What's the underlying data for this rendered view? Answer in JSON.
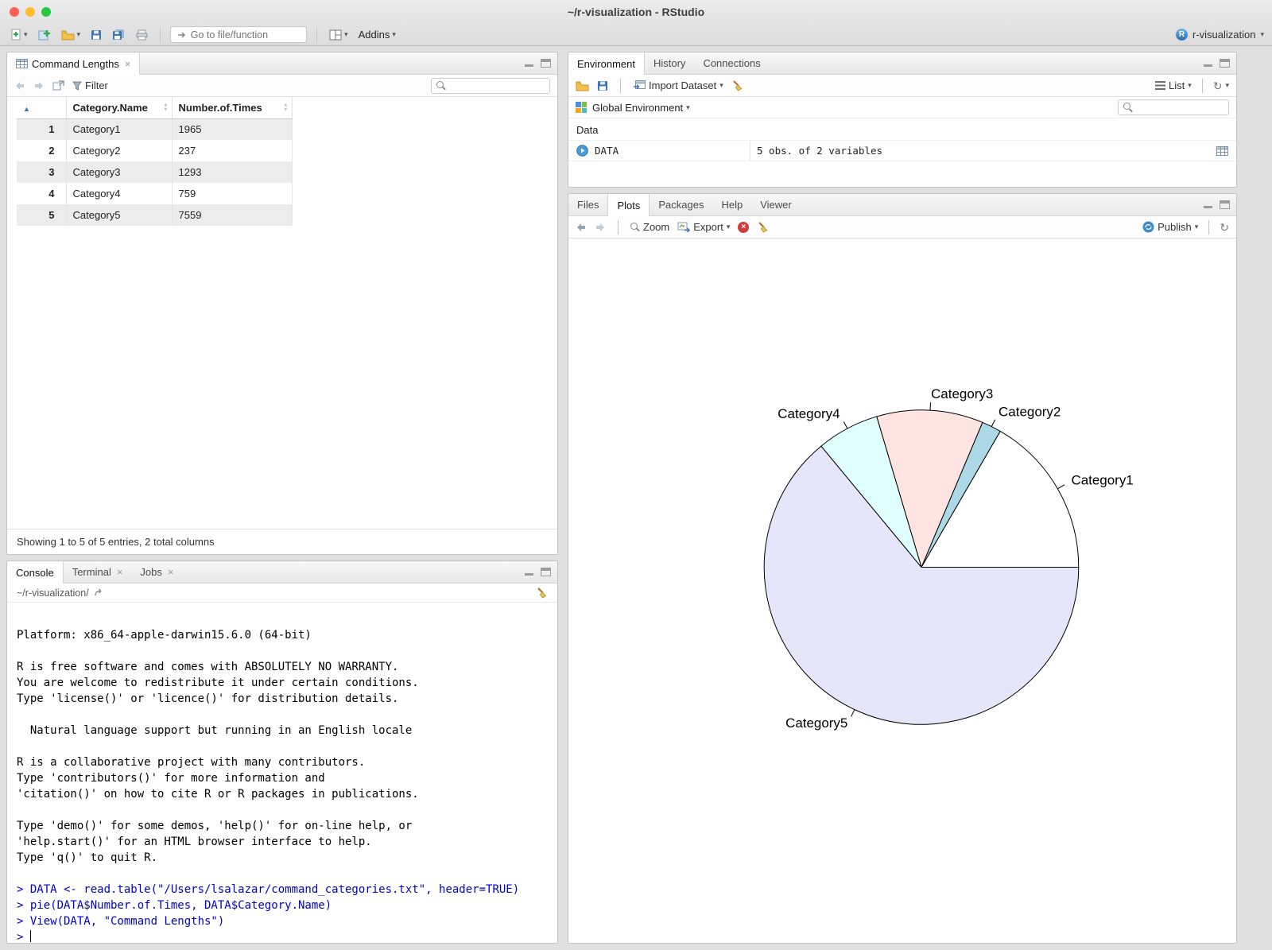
{
  "window": {
    "title": "~/r-visualization - RStudio"
  },
  "main_toolbar": {
    "goto_placeholder": "Go to file/function",
    "addins_label": "Addins",
    "project_label": "r-visualization"
  },
  "data_viewer": {
    "tab_title": "Command Lengths",
    "filter_label": "Filter",
    "columns": {
      "name": "Category.Name",
      "times": "Number.of.Times"
    },
    "rows": [
      {
        "n": "1",
        "name": "Category1",
        "times": "1965"
      },
      {
        "n": "2",
        "name": "Category2",
        "times": "237"
      },
      {
        "n": "3",
        "name": "Category3",
        "times": "1293"
      },
      {
        "n": "4",
        "name": "Category4",
        "times": "759"
      },
      {
        "n": "5",
        "name": "Category5",
        "times": "7559"
      }
    ],
    "footer": "Showing 1 to 5 of 5 entries, 2 total columns"
  },
  "console": {
    "tabs": [
      "Console",
      "Terminal",
      "Jobs"
    ],
    "path": "~/r-visualization/",
    "lines": [
      {
        "kind": "output",
        "text": "Platform: x86_64-apple-darwin15.6.0 (64-bit)"
      },
      {
        "kind": "output",
        "text": ""
      },
      {
        "kind": "output",
        "text": "R is free software and comes with ABSOLUTELY NO WARRANTY."
      },
      {
        "kind": "output",
        "text": "You are welcome to redistribute it under certain conditions."
      },
      {
        "kind": "output",
        "text": "Type 'license()' or 'licence()' for distribution details."
      },
      {
        "kind": "output",
        "text": ""
      },
      {
        "kind": "output",
        "text": "  Natural language support but running in an English locale"
      },
      {
        "kind": "output",
        "text": ""
      },
      {
        "kind": "output",
        "text": "R is a collaborative project with many contributors."
      },
      {
        "kind": "output",
        "text": "Type 'contributors()' for more information and"
      },
      {
        "kind": "output",
        "text": "'citation()' on how to cite R or R packages in publications."
      },
      {
        "kind": "output",
        "text": ""
      },
      {
        "kind": "output",
        "text": "Type 'demo()' for some demos, 'help()' for on-line help, or"
      },
      {
        "kind": "output",
        "text": "'help.start()' for an HTML browser interface to help."
      },
      {
        "kind": "output",
        "text": "Type 'q()' to quit R."
      },
      {
        "kind": "output",
        "text": ""
      },
      {
        "kind": "input",
        "text": "> DATA <- read.table(\"/Users/lsalazar/command_categories.txt\", header=TRUE)"
      },
      {
        "kind": "input",
        "text": "> pie(DATA$Number.of.Times, DATA$Category.Name)"
      },
      {
        "kind": "input",
        "text": "> View(DATA, \"Command Lengths\")"
      },
      {
        "kind": "input",
        "text": "> ",
        "cursor": true
      }
    ]
  },
  "environment": {
    "tabs": [
      "Environment",
      "History",
      "Connections"
    ],
    "toolbar": {
      "import_label": "Import Dataset",
      "list_label": "List"
    },
    "scope_label": "Global Environment",
    "section_label": "Data",
    "entries": [
      {
        "name": "DATA",
        "value": "5 obs. of 2 variables"
      }
    ]
  },
  "plots": {
    "tabs": [
      "Files",
      "Plots",
      "Packages",
      "Help",
      "Viewer"
    ],
    "toolbar": {
      "zoom_label": "Zoom",
      "export_label": "Export",
      "publish_label": "Publish"
    }
  },
  "chart_data": {
    "type": "pie",
    "title": "",
    "categories": [
      "Category1",
      "Category2",
      "Category3",
      "Category4",
      "Category5"
    ],
    "values": [
      1965,
      237,
      1293,
      759,
      7559
    ],
    "colors": [
      "#FFFFFF",
      "#ADD8E6",
      "#FFE4E1",
      "#E0FFFF",
      "#E6E6FA"
    ],
    "stroke": "#000000",
    "start_angle_deg": 0,
    "direction": "counterclockwise",
    "legend": "labels-with-leader-lines"
  }
}
